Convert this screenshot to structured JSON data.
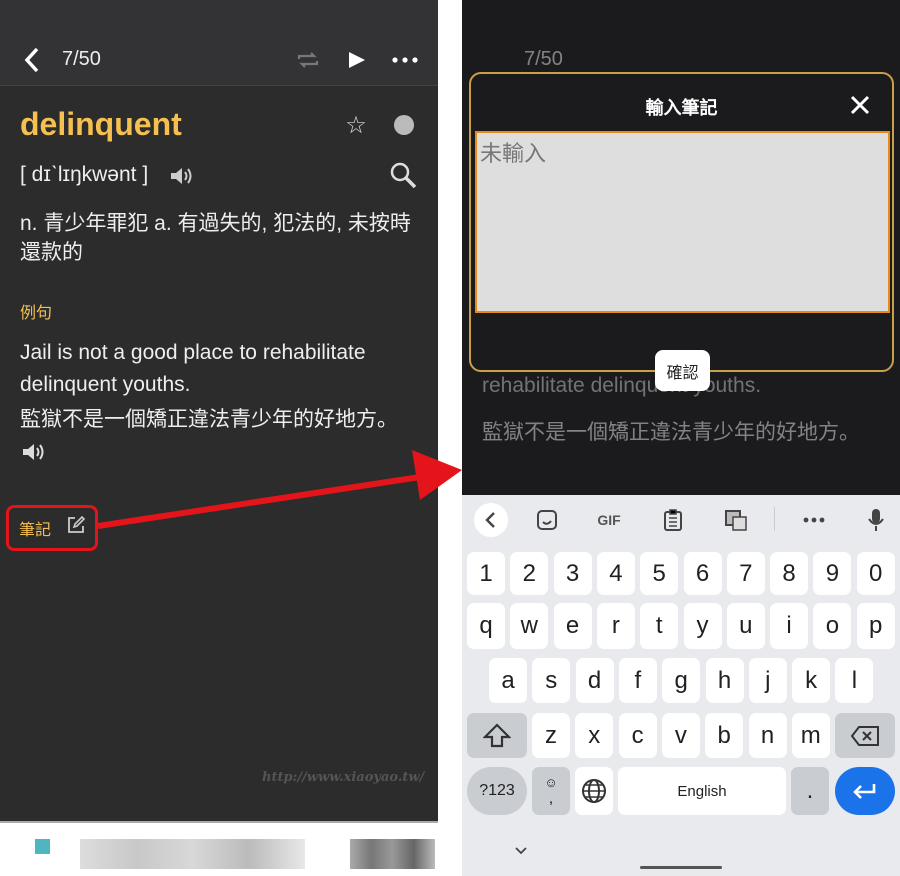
{
  "left": {
    "header": {
      "counter": "7/50",
      "icons": [
        "back-icon",
        "repeat-icon",
        "play-icon",
        "more-icon"
      ]
    },
    "word": "delinquent",
    "phonetic": "[ dɪˋlɪŋkwənt ]",
    "definition": "n. 青少年罪犯  a. 有過失的, 犯法的, 未按時還款的",
    "example_label": "例句",
    "example_en": "Jail is not a good place to rehabilitate delinquent youths.",
    "example_zh": "監獄不是一個矯正違法青少年的好地方。",
    "note_label": "筆記",
    "watermark": "http://www.xiaoyao.tw/",
    "colors": {
      "accent": "#f5c04f",
      "highlight": "#e4141b"
    }
  },
  "right": {
    "header": {
      "counter": "7/50"
    },
    "background_text_en": "rehabilitate delinquent youths.",
    "background_text_zh": "監獄不是一個矯正違法青少年的好地方。",
    "modal": {
      "title": "輸入筆記",
      "placeholder": "未輸入",
      "confirm": "確認"
    },
    "keyboard": {
      "toolbar": [
        "back-icon",
        "sticker-icon",
        "GIF",
        "clipboard-icon",
        "translate-icon",
        "more-icon",
        "mic-icon"
      ],
      "rows": [
        [
          "1",
          "2",
          "3",
          "4",
          "5",
          "6",
          "7",
          "8",
          "9",
          "0"
        ],
        [
          "q",
          "w",
          "e",
          "r",
          "t",
          "y",
          "u",
          "i",
          "o",
          "p"
        ],
        [
          "a",
          "s",
          "d",
          "f",
          "g",
          "h",
          "j",
          "k",
          "l"
        ],
        [
          "z",
          "x",
          "c",
          "v",
          "b",
          "n",
          "m"
        ]
      ],
      "symbols": "?123",
      "space": "English",
      "period": ".",
      "emoji_comma": ",",
      "enter_color": "#1a73e8"
    }
  }
}
